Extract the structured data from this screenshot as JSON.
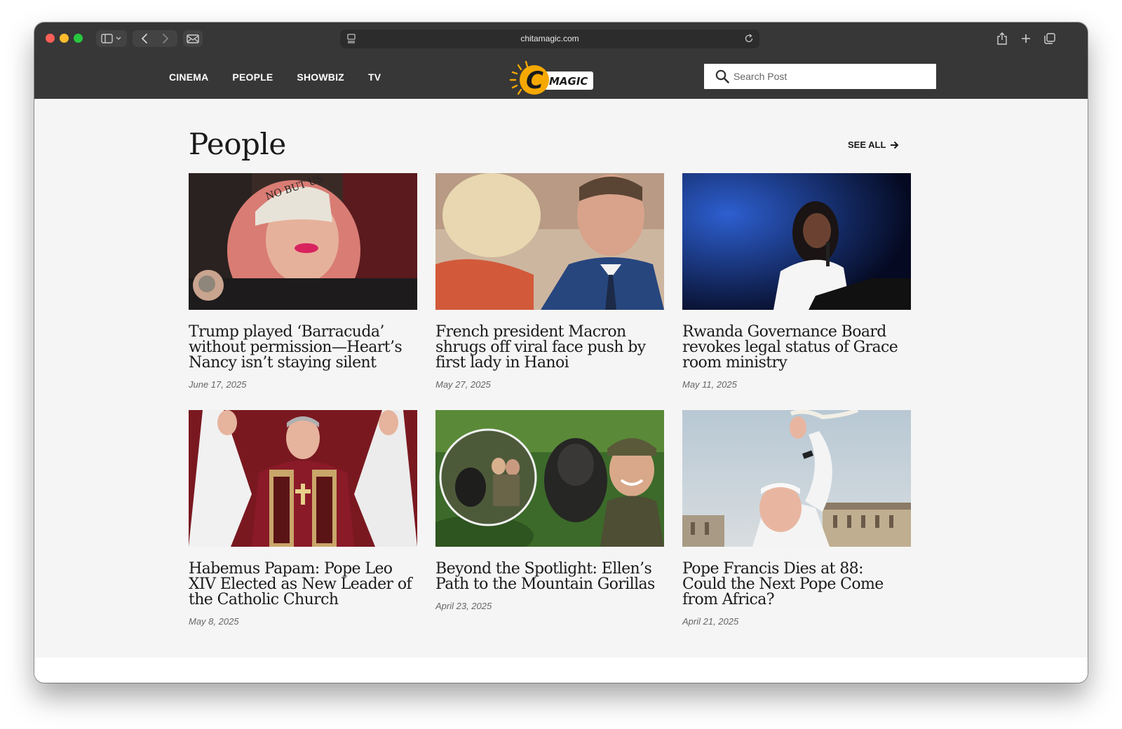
{
  "browser": {
    "url": "chitamagic.com"
  },
  "site": {
    "nav": [
      "CINEMA",
      "PEOPLE",
      "SHOWBIZ",
      "TV"
    ],
    "logo_letter": "C",
    "logo_text": "MAGIC",
    "search_placeholder": "Search Post"
  },
  "section": {
    "title": "People",
    "see_all": "SEE ALL",
    "articles": [
      {
        "title": "Trump played ‘Barracuda’ without permission—Heart’s Nancy isn’t staying silent",
        "date": "June 17, 2025",
        "cap_text": "NO BUT US"
      },
      {
        "title": "French president Macron shrugs off viral face push by first lady in Hanoi",
        "date": "May 27, 2025"
      },
      {
        "title": "Rwanda Governance Board revokes legal status of Grace room ministry",
        "date": "May 11, 2025"
      },
      {
        "title": "Habemus Papam: Pope Leo XIV Elected as New Leader of the Catholic Church",
        "date": "May 8, 2025"
      },
      {
        "title": "Beyond the Spotlight: Ellen’s Path to the Mountain Gorillas",
        "date": "April 23, 2025"
      },
      {
        "title": "Pope Francis Dies at 88: Could the Next Pope Come from Africa?",
        "date": "April 21, 2025"
      }
    ]
  },
  "colors": {
    "header_bg": "#373737",
    "logo_orange": "#f5a800",
    "page_bg": "#f5f5f5"
  }
}
